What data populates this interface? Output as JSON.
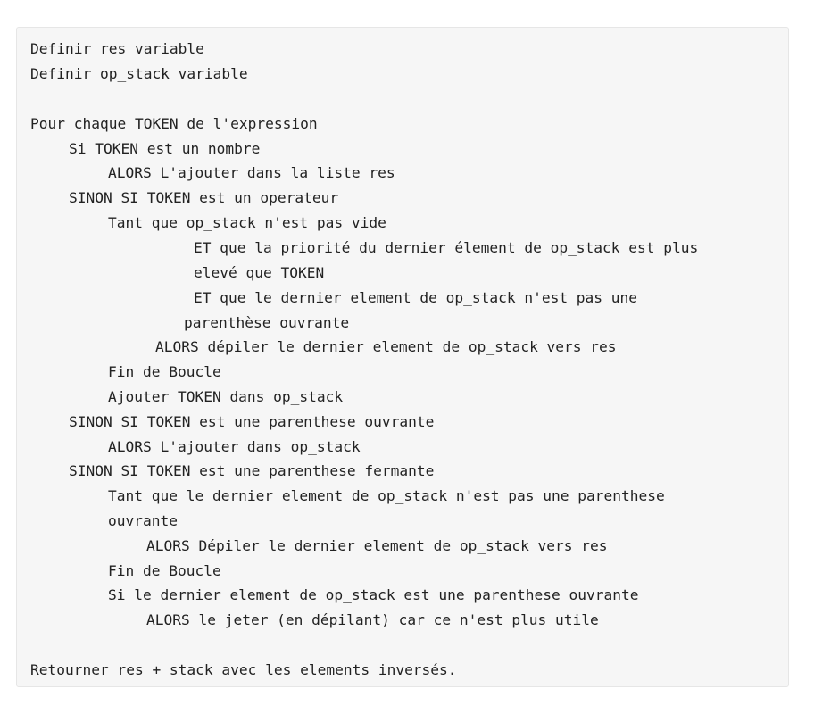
{
  "code": {
    "lines": [
      "Definir res variable",
      "Definir op_stack variable",
      "",
      "Pour chaque TOKEN de l'expression",
      "Si TOKEN est un nombre",
      "ALORS L'ajouter dans la liste res",
      "SINON SI TOKEN est un operateur",
      "Tant que op_stack n'est pas vide",
      "ET que la priorité du dernier élement de op_stack est plus",
      "elevé que TOKEN",
      "ET que le dernier element de op_stack n'est pas une",
      "parenthèse ouvrante",
      "ALORS dépiler le dernier element de op_stack vers res",
      "Fin de Boucle",
      "Ajouter TOKEN dans op_stack",
      "SINON SI TOKEN est une parenthese ouvrante",
      "ALORS L'ajouter dans op_stack",
      "SINON SI TOKEN est une parenthese fermante",
      "Tant que le dernier element de op_stack n'est pas une parenthese",
      "ouvrante",
      "ALORS Dépiler le dernier element de op_stack vers res",
      "Fin de Boucle",
      "Si le dernier element de op_stack est une parenthese ouvrante",
      "ALORS le jeter (en dépilant) car ce n'est plus utile",
      "",
      "Retourner res + stack avec les elements inversés."
    ]
  }
}
